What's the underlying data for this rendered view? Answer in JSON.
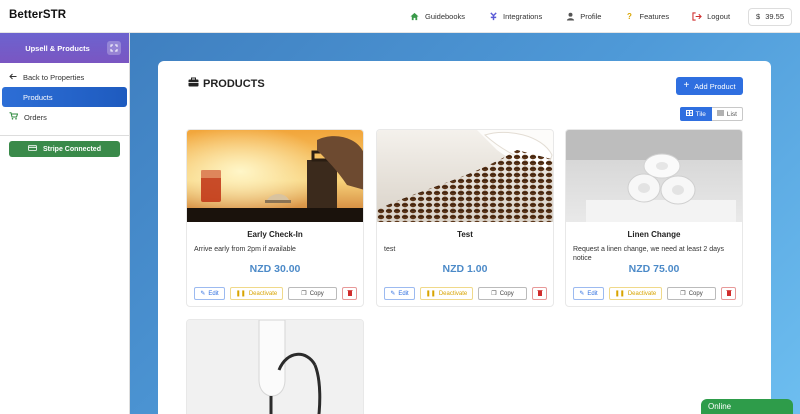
{
  "brand": "BetterSTR",
  "nav": {
    "items": [
      {
        "label": "Guidebooks",
        "icon": "home-icon"
      },
      {
        "label": "Integrations",
        "icon": "integrations-icon"
      },
      {
        "label": "Profile",
        "icon": "user-icon"
      },
      {
        "label": "Features",
        "icon": "question-icon"
      },
      {
        "label": "Logout",
        "icon": "logout-icon"
      }
    ],
    "balance": "39.55"
  },
  "sidebar": {
    "title": "Upsell & Products",
    "items": [
      {
        "label": "Back to Properties",
        "icon": "arrow-left-icon"
      },
      {
        "label": "Products",
        "icon": ""
      },
      {
        "label": "Orders",
        "icon": "cart-icon"
      }
    ],
    "stripe_label": "Stripe Connected"
  },
  "main": {
    "title": "PRODUCTS",
    "add_button": "Add Product",
    "view": {
      "tile": "Tile",
      "list": "List",
      "selected": "Tile"
    },
    "actions": {
      "edit": "Edit",
      "deactivate": "Deactivate",
      "copy": "Copy"
    },
    "products": [
      {
        "name": "Early Check-In",
        "description": "Arrive early from 2pm if available",
        "price": "NZD 30.00"
      },
      {
        "name": "Test",
        "description": "test",
        "price": "NZD 1.00"
      },
      {
        "name": "Linen Change",
        "description": "Request a linen change, we need at least 2 days notice",
        "price": "NZD 75.00"
      }
    ]
  },
  "status": {
    "online": "Online"
  },
  "colors": {
    "accent": "#2f6fe0",
    "price": "#4c8ac8",
    "stripe": "#3a8a4a",
    "sidebar_header": "#6c63cf"
  }
}
